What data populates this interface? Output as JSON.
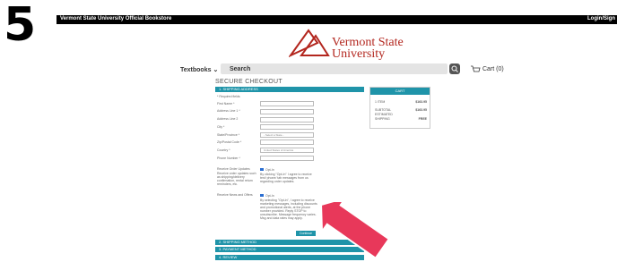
{
  "step_number": "5",
  "topbar": {
    "left": "Vermont State University Official Bookstore",
    "right": "Login/Sign"
  },
  "logo": {
    "line1": "Vermont State",
    "line2": "University"
  },
  "nav": {
    "textbooks": "Textbooks",
    "search_placeholder": "Search",
    "cart": "Cart (0)"
  },
  "checkout": {
    "title": "SECURE CHECKOUT",
    "step1": "1. SHIPPING ADDRESS",
    "required_note": "* Required fields",
    "fields": {
      "first_name": "First Name *",
      "addr1": "Address Line 1 *",
      "addr2": "Address Line 2",
      "city": "City *",
      "state": "State/Province *",
      "zip": "Zip/Postal Code *",
      "country": "Country *",
      "phone": "Phone Number *"
    },
    "state_value": "- Select a State -",
    "country_value": "United States of America",
    "order_updates_label": "Receive Order Updates",
    "order_updates_desc": "Receive order updates such as shipping/delivery confirmation, rental return reminders, etc.",
    "opt_in": "Opt-In",
    "order_updates_consent": "By clicking \"Opt-In\" I agree to receive text/ phone/ tab messages from us regarding order updates.",
    "news_label": "Receive News and Offers",
    "news_consent": "By selecting \"Opt-in\", I agree to receive marketing messages, including discounts and promotional alerts, at the phone number provided. Reply STOP to unsubscribe. Message frequency varies. Msg and data rates may apply.",
    "continue": "Continue",
    "step2": "2. SHIPPING METHOD",
    "step3": "3. PAYMENT METHOD",
    "step4": "4. REVIEW"
  },
  "cart_summary": {
    "header": "CART",
    "rows": [
      {
        "label": "1 ITEM",
        "value": "$163.95"
      },
      {
        "label": "SUBTOTAL",
        "value": "$163.95"
      },
      {
        "label": "SHIPPING",
        "value": "FREE"
      }
    ],
    "estimated": "ESTIMATED"
  },
  "colors": {
    "accent": "#1f94a9",
    "brand": "#b3261e",
    "arrow": "#e8385a"
  }
}
